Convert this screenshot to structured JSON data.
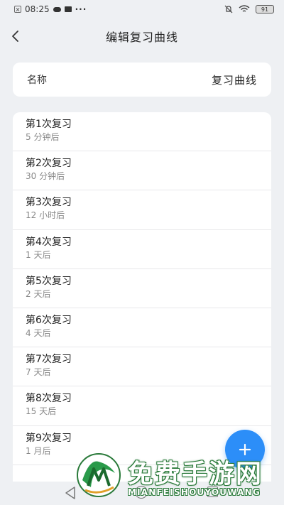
{
  "status_bar": {
    "time": "08:25",
    "dots": "···",
    "battery": "91"
  },
  "header": {
    "title": "编辑复习曲线"
  },
  "name_row": {
    "label": "名称",
    "value": "复习曲线"
  },
  "reviews": [
    {
      "title": "第1次复习",
      "interval": "5 分钟后"
    },
    {
      "title": "第2次复习",
      "interval": "30 分钟后"
    },
    {
      "title": "第3次复习",
      "interval": "12 小时后"
    },
    {
      "title": "第4次复习",
      "interval": "1 天后"
    },
    {
      "title": "第5次复习",
      "interval": "2 天后"
    },
    {
      "title": "第6次复习",
      "interval": "4 天后"
    },
    {
      "title": "第7次复习",
      "interval": "7 天后"
    },
    {
      "title": "第8次复习",
      "interval": "15 天后"
    },
    {
      "title": "第9次复习",
      "interval": "1 月后"
    }
  ],
  "fab": {
    "icon": "plus-icon",
    "color": "#2c8ef8"
  },
  "watermark": {
    "text": "免费手游网",
    "pinyin": "MIANFEISHOUYOUWANG"
  }
}
